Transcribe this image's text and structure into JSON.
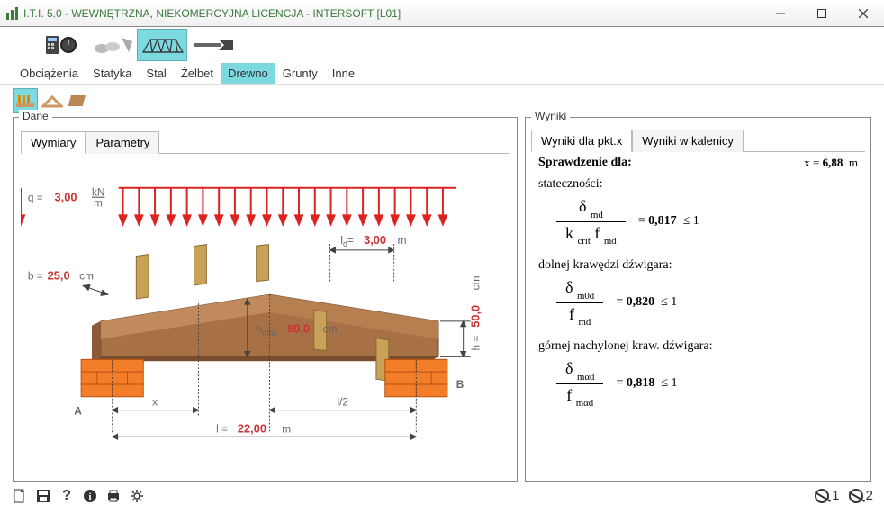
{
  "window": {
    "title": "I.T.I. 5.0 - WEWNĘTRZNA, NIEKOMERCYJNA LICENCJA - INTERSOFT [L01]"
  },
  "menu": {
    "items": [
      "Obciążenia",
      "Statyka",
      "Stal",
      "Żelbet",
      "Drewno",
      "Grunty",
      "Inne"
    ],
    "active": 4
  },
  "dane": {
    "panel_title": "Dane",
    "tabs": [
      "Wymiary",
      "Parametry"
    ],
    "active_tab": 0,
    "diagram": {
      "q_label": "q  =",
      "q_value": "3,00",
      "q_unit_num": "kN",
      "q_unit_den": "m",
      "b_label": "b =",
      "b_value": "25,0",
      "b_unit": "cm",
      "ld_label_pre": "l",
      "ld_label_sub": "d",
      "ld_eq": "=",
      "ld_value": "3,00",
      "ld_unit": "m",
      "hmax_label_pre": "h",
      "hmax_label_sub": "max",
      "hmax_value": "80,0",
      "hmax_unit": "cm",
      "h_label": "h =",
      "h_value": "50,0",
      "h_unit": "cm",
      "x_label": "x",
      "l2_label": "l/2",
      "l_label": "l =",
      "l_value": "22,00",
      "l_unit": "m",
      "A": "A",
      "B": "B"
    }
  },
  "wyniki": {
    "panel_title": "Wyniki",
    "tabs": [
      "Wyniki dla pkt.x",
      "Wyniki w kalenicy"
    ],
    "active_tab": 0,
    "check_title": "Sprawdzenie dla:",
    "x_label": "x =",
    "x_value": "6,88",
    "x_unit": "m",
    "rows": [
      {
        "pre_label": "stateczności:",
        "num_html": "δ <sub>md</sub>",
        "den_html": "k <sub>crit</sub> f <sub>md</sub>",
        "eq": "=",
        "val": "0,817",
        "lim": "≤ 1"
      },
      {
        "pre_label": "dolnej krawędzi dźwigara:",
        "num_html": "δ <sub>m0d</sub>",
        "den_html": "f <sub>md</sub>",
        "eq": "=",
        "val": "0,820",
        "lim": "≤ 1"
      },
      {
        "pre_label": "górnej nachylonej kraw. dźwigara:",
        "num_html": "δ <sub>mαd</sub>",
        "den_html": "f <sub>mαd</sub>",
        "eq": "=",
        "val": "0,818",
        "lim": "≤ 1"
      }
    ]
  },
  "status": {
    "right_1": "1",
    "right_2": "2"
  }
}
